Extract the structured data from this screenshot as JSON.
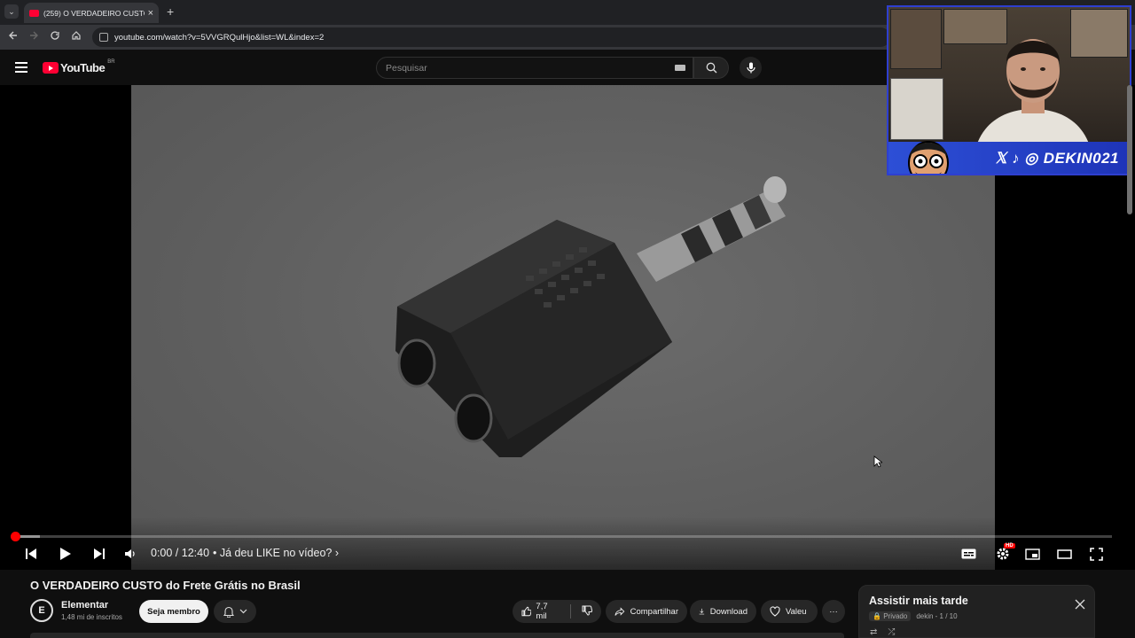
{
  "browser": {
    "tab_title": "(259) O VERDADEIRO CUSTO do Frete Grátis no Brasil",
    "url": "youtube.com/watch?v=5VVGRQulHjo&list=WL&index=2",
    "close_glyph": "×",
    "newtab_glyph": "+"
  },
  "youtube": {
    "logo_text": "YouTube",
    "region": "BR",
    "search_placeholder": "Pesquisar"
  },
  "player": {
    "time": "0:00 / 12:40",
    "chapter": "• Já deu LIKE no vídeo? ›",
    "progress_played": 0.0,
    "progress_buffered": 0.023,
    "quality_badge": "HD"
  },
  "webcam": {
    "handle": "DEKIN021"
  },
  "video": {
    "title": "O VERDADEIRO CUSTO do Frete Grátis no Brasil",
    "channel_initial": "E",
    "channel_name": "Elementar",
    "subscribers": "1,48 mi de inscritos",
    "member_label": "Seja membro",
    "like_count": "7,7 mil",
    "share_label": "Compartilhar",
    "download_label": "Download",
    "thanks_label": "Valeu",
    "more_glyph": "···"
  },
  "watch_later": {
    "title": "Assistir mais tarde",
    "privacy": "Privado",
    "owner_position": "dekin - 1 / 10"
  },
  "colors": {
    "accent_red": "#ff0033",
    "cam_banner": "#2d4fd6"
  }
}
